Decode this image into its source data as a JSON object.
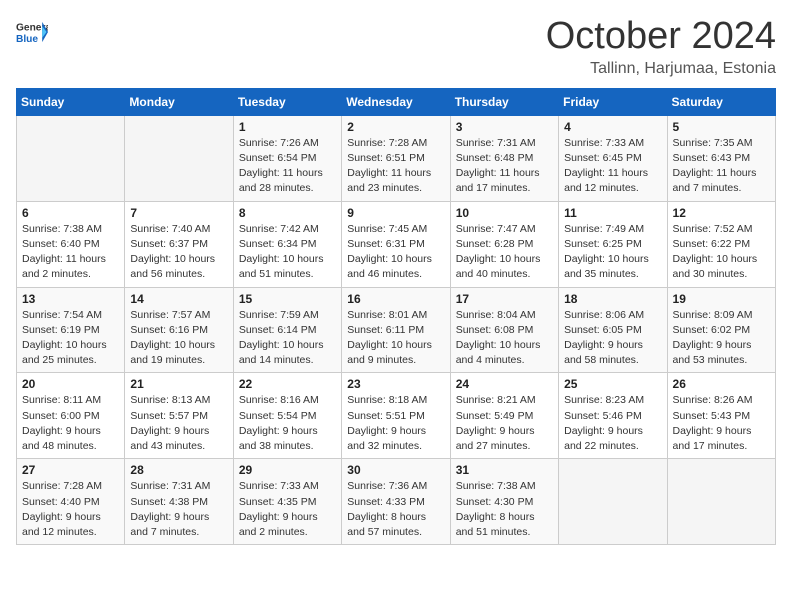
{
  "header": {
    "logo_general": "General",
    "logo_blue": "Blue",
    "title": "October 2024",
    "location": "Tallinn, Harjumaa, Estonia"
  },
  "weekdays": [
    "Sunday",
    "Monday",
    "Tuesday",
    "Wednesday",
    "Thursday",
    "Friday",
    "Saturday"
  ],
  "weeks": [
    [
      {
        "day": "",
        "info": ""
      },
      {
        "day": "",
        "info": ""
      },
      {
        "day": "1",
        "info": "Sunrise: 7:26 AM\nSunset: 6:54 PM\nDaylight: 11 hours and 28 minutes."
      },
      {
        "day": "2",
        "info": "Sunrise: 7:28 AM\nSunset: 6:51 PM\nDaylight: 11 hours and 23 minutes."
      },
      {
        "day": "3",
        "info": "Sunrise: 7:31 AM\nSunset: 6:48 PM\nDaylight: 11 hours and 17 minutes."
      },
      {
        "day": "4",
        "info": "Sunrise: 7:33 AM\nSunset: 6:45 PM\nDaylight: 11 hours and 12 minutes."
      },
      {
        "day": "5",
        "info": "Sunrise: 7:35 AM\nSunset: 6:43 PM\nDaylight: 11 hours and 7 minutes."
      }
    ],
    [
      {
        "day": "6",
        "info": "Sunrise: 7:38 AM\nSunset: 6:40 PM\nDaylight: 11 hours and 2 minutes."
      },
      {
        "day": "7",
        "info": "Sunrise: 7:40 AM\nSunset: 6:37 PM\nDaylight: 10 hours and 56 minutes."
      },
      {
        "day": "8",
        "info": "Sunrise: 7:42 AM\nSunset: 6:34 PM\nDaylight: 10 hours and 51 minutes."
      },
      {
        "day": "9",
        "info": "Sunrise: 7:45 AM\nSunset: 6:31 PM\nDaylight: 10 hours and 46 minutes."
      },
      {
        "day": "10",
        "info": "Sunrise: 7:47 AM\nSunset: 6:28 PM\nDaylight: 10 hours and 40 minutes."
      },
      {
        "day": "11",
        "info": "Sunrise: 7:49 AM\nSunset: 6:25 PM\nDaylight: 10 hours and 35 minutes."
      },
      {
        "day": "12",
        "info": "Sunrise: 7:52 AM\nSunset: 6:22 PM\nDaylight: 10 hours and 30 minutes."
      }
    ],
    [
      {
        "day": "13",
        "info": "Sunrise: 7:54 AM\nSunset: 6:19 PM\nDaylight: 10 hours and 25 minutes."
      },
      {
        "day": "14",
        "info": "Sunrise: 7:57 AM\nSunset: 6:16 PM\nDaylight: 10 hours and 19 minutes."
      },
      {
        "day": "15",
        "info": "Sunrise: 7:59 AM\nSunset: 6:14 PM\nDaylight: 10 hours and 14 minutes."
      },
      {
        "day": "16",
        "info": "Sunrise: 8:01 AM\nSunset: 6:11 PM\nDaylight: 10 hours and 9 minutes."
      },
      {
        "day": "17",
        "info": "Sunrise: 8:04 AM\nSunset: 6:08 PM\nDaylight: 10 hours and 4 minutes."
      },
      {
        "day": "18",
        "info": "Sunrise: 8:06 AM\nSunset: 6:05 PM\nDaylight: 9 hours and 58 minutes."
      },
      {
        "day": "19",
        "info": "Sunrise: 8:09 AM\nSunset: 6:02 PM\nDaylight: 9 hours and 53 minutes."
      }
    ],
    [
      {
        "day": "20",
        "info": "Sunrise: 8:11 AM\nSunset: 6:00 PM\nDaylight: 9 hours and 48 minutes."
      },
      {
        "day": "21",
        "info": "Sunrise: 8:13 AM\nSunset: 5:57 PM\nDaylight: 9 hours and 43 minutes."
      },
      {
        "day": "22",
        "info": "Sunrise: 8:16 AM\nSunset: 5:54 PM\nDaylight: 9 hours and 38 minutes."
      },
      {
        "day": "23",
        "info": "Sunrise: 8:18 AM\nSunset: 5:51 PM\nDaylight: 9 hours and 32 minutes."
      },
      {
        "day": "24",
        "info": "Sunrise: 8:21 AM\nSunset: 5:49 PM\nDaylight: 9 hours and 27 minutes."
      },
      {
        "day": "25",
        "info": "Sunrise: 8:23 AM\nSunset: 5:46 PM\nDaylight: 9 hours and 22 minutes."
      },
      {
        "day": "26",
        "info": "Sunrise: 8:26 AM\nSunset: 5:43 PM\nDaylight: 9 hours and 17 minutes."
      }
    ],
    [
      {
        "day": "27",
        "info": "Sunrise: 7:28 AM\nSunset: 4:40 PM\nDaylight: 9 hours and 12 minutes."
      },
      {
        "day": "28",
        "info": "Sunrise: 7:31 AM\nSunset: 4:38 PM\nDaylight: 9 hours and 7 minutes."
      },
      {
        "day": "29",
        "info": "Sunrise: 7:33 AM\nSunset: 4:35 PM\nDaylight: 9 hours and 2 minutes."
      },
      {
        "day": "30",
        "info": "Sunrise: 7:36 AM\nSunset: 4:33 PM\nDaylight: 8 hours and 57 minutes."
      },
      {
        "day": "31",
        "info": "Sunrise: 7:38 AM\nSunset: 4:30 PM\nDaylight: 8 hours and 51 minutes."
      },
      {
        "day": "",
        "info": ""
      },
      {
        "day": "",
        "info": ""
      }
    ]
  ]
}
